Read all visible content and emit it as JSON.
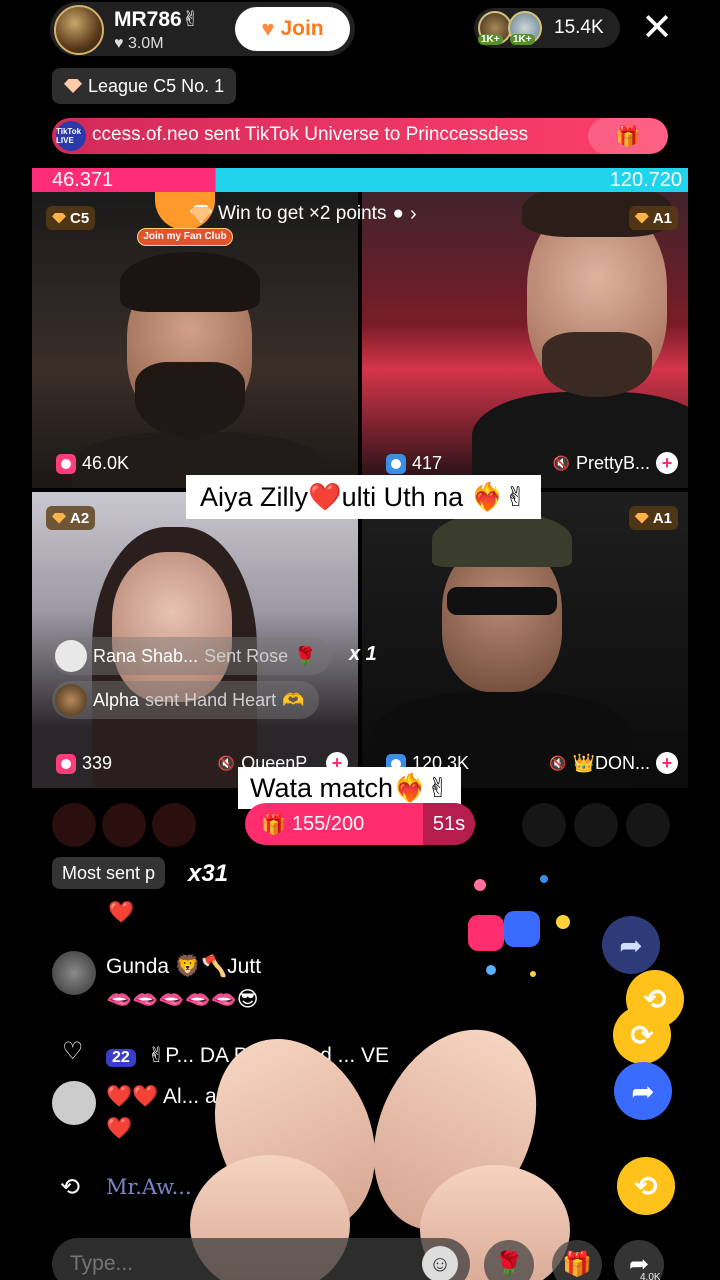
{
  "host": {
    "name": "MR786✌",
    "likes": "3.0M",
    "join_label": "Join"
  },
  "viewers": {
    "badge_1": "1K+",
    "badge_2": "1K+",
    "count": "15.4K"
  },
  "league": "League C5 No. 1",
  "gift_banner": {
    "logo": "TikTok LIVE",
    "text": "ccess.of.neo sent TikTok Universe to Princcessdess"
  },
  "score": {
    "left": "46.371",
    "right": "120.720"
  },
  "win_banner": "Win to get ×2 points",
  "fan_club_label": "Join my Fan Club",
  "tiles": [
    {
      "rank": "C5",
      "count": "46.0K"
    },
    {
      "rank": "A1",
      "count": "417",
      "name": "PrettyB..."
    },
    {
      "rank": "A2",
      "count": "339",
      "name": "QueenP..."
    },
    {
      "rank": "A1",
      "count": "120.3K",
      "name": "👑DON..."
    }
  ],
  "captions": {
    "first": "Aiya Zilly❤️ulti Uth na ❤️‍🔥✌",
    "second": "Wata match❤️‍🔥✌"
  },
  "gift_toasts": [
    {
      "user": "Rana Shab...",
      "action": "Sent Rose",
      "emoji": "🌹",
      "count": "x 1"
    },
    {
      "user": "Alpha",
      "action": "sent Hand Heart",
      "emoji": "🫶"
    }
  ],
  "battle": {
    "progress": "155/200",
    "timer": "51s"
  },
  "most_sent": {
    "label": "Most sent p",
    "count": "x31"
  },
  "chat": [
    {
      "text": "❤️"
    },
    {
      "user": "Gunda 🦁🪓Jutt",
      "message": "🫦🫦🫦🫦🫦😎"
    },
    {
      "level": "22",
      "text": "✌P... DA PM✌ liked ... VE"
    },
    {
      "user": "Al... azi",
      "message": "❤️❤️ Al... azi❤️❤️❤️",
      "sub": "❤️"
    },
    {
      "user": "Mr.Aw...",
      "action": "reposted"
    }
  ],
  "composer": {
    "placeholder": "Type...",
    "share_count": "4.0K"
  },
  "colors": {
    "accent_pink": "#ff2d6d",
    "score_blue": "#22d3ee",
    "repost_yellow": "#ffc21a"
  }
}
